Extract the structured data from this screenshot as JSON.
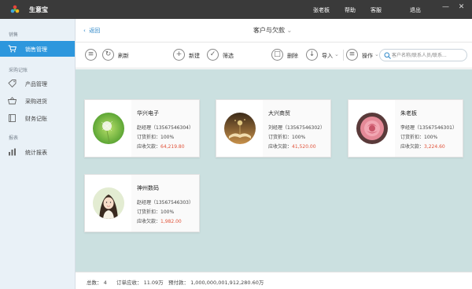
{
  "app": {
    "title": "生意宝",
    "nav": [
      "张老板",
      "帮助",
      "客服",
      "退出"
    ],
    "window_controls": [
      "minimize-icon",
      "close-icon"
    ]
  },
  "sidebar": {
    "sections": [
      {
        "title": "销售",
        "items": [
          {
            "label": "销售管理",
            "icon": "cart-icon",
            "active": true
          }
        ]
      },
      {
        "title": "采购记账",
        "items": [
          {
            "label": "产品管理",
            "icon": "tag-icon",
            "active": false
          },
          {
            "label": "采购进货",
            "icon": "basket-icon",
            "active": false
          },
          {
            "label": "财务记账",
            "icon": "ledger-icon",
            "active": false
          }
        ]
      },
      {
        "title": "报表",
        "items": [
          {
            "label": "统计报表",
            "icon": "bar-chart-icon",
            "active": false
          }
        ]
      }
    ]
  },
  "header": {
    "back_label": "返回",
    "title": "客户与欠款"
  },
  "toolbar": {
    "refresh_label": "刷新",
    "new_label": "新建",
    "filter_label": "筛选",
    "delete_label": "删除",
    "import_label": "导入",
    "actions_label": "操作",
    "search_placeholder": "客户名称/联系人员/联系..."
  },
  "customers": [
    {
      "name": "华兴电子",
      "contact": "赵经理（13567546304）",
      "discount": "订货折扣：100%",
      "due_label": "应收欠款：",
      "due": "64,219.80",
      "avatar": "dandelion"
    },
    {
      "name": "大兴商贸",
      "contact": "刘经理（13567546302）",
      "discount": "订货折扣：100%",
      "due_label": "应收欠款：",
      "due": "41,520.00",
      "avatar": "book"
    },
    {
      "name": "朱老板",
      "contact": "李经理（13567546301）",
      "discount": "订货折扣：100%",
      "due_label": "应收欠款：",
      "due": "3,224.60",
      "avatar": "rose"
    },
    {
      "name": "神州数码",
      "contact": "赵经理（13567546303）",
      "discount": "订货折扣：100%",
      "due_label": "应收欠款：",
      "due": "1,982.00",
      "avatar": "girl"
    }
  ],
  "status": {
    "total": "总数：  4",
    "orders": "订单应收：  11.09万",
    "prepaid": "预付款：  1,000,000,001,912,280.60万"
  },
  "colors": {
    "accent": "#2d97dd",
    "due": "#e0533a",
    "content_bg": "#cbe0e0",
    "titlebar": "#3a3a3a"
  }
}
